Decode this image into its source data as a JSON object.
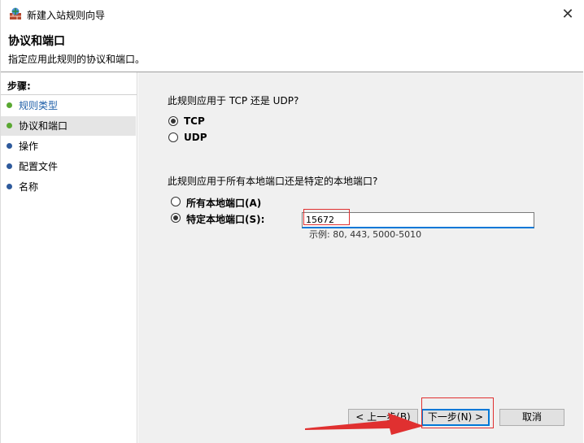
{
  "window": {
    "title": "新建入站规则向导",
    "close_symbol": "✕"
  },
  "header": {
    "title": "协议和端口",
    "description": "指定应用此规则的协议和端口。"
  },
  "sidebar": {
    "steps_title": "步骤:",
    "items": [
      {
        "label": "规则类型",
        "state": "done"
      },
      {
        "label": "协议和端口",
        "state": "current"
      },
      {
        "label": "操作",
        "state": "pending"
      },
      {
        "label": "配置文件",
        "state": "pending"
      },
      {
        "label": "名称",
        "state": "pending"
      }
    ]
  },
  "main": {
    "protocol_question": "此规则应用于 TCP 还是 UDP?",
    "protocol_options": [
      {
        "label": "TCP",
        "selected": true
      },
      {
        "label": "UDP",
        "selected": false
      }
    ],
    "port_question": "此规则应用于所有本地端口还是特定的本地端口?",
    "port_options": [
      {
        "label": "所有本地端口(A)",
        "selected": false
      },
      {
        "label": "特定本地端口(S):",
        "selected": true
      }
    ],
    "port_value": "15672",
    "port_example": "示例: 80, 443, 5000-5010"
  },
  "buttons": {
    "back": "< 上一步(B)",
    "next": "下一步(N) >",
    "cancel": "取消"
  },
  "colors": {
    "step_done": "#5aa832",
    "step_pending": "#2e5a9c",
    "annotation": "#e03030",
    "focus": "#0078d7"
  }
}
